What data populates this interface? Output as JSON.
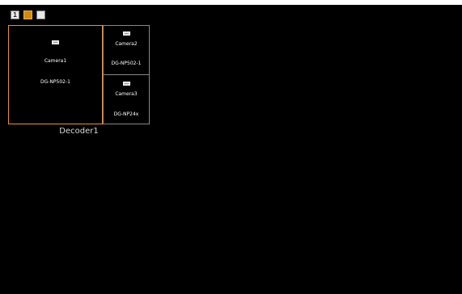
{
  "toolbar": {
    "layout_1_label": "1",
    "layout_buttons": [
      "layout-1",
      "layout-1plus2",
      "layout-9"
    ]
  },
  "decoder": {
    "name": "Decoder1",
    "tiles": [
      {
        "camera": "Camera1",
        "device": "DG-NP502-1",
        "selected": true
      },
      {
        "camera": "Camera2",
        "device": "DG-NP502-1",
        "selected": false
      },
      {
        "camera": "Camera3",
        "device": "DG-NP24x",
        "selected": false
      }
    ]
  },
  "colors": {
    "background": "#000000",
    "selected_border": "#e8903a",
    "tile_border": "#888888"
  },
  "icons": [
    "camera-icon",
    "layout-1-icon",
    "layout-1plus2-icon",
    "layout-9-icon"
  ]
}
